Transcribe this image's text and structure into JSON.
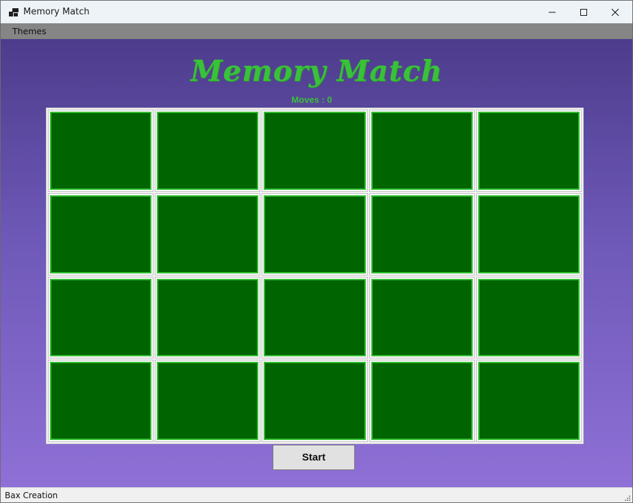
{
  "window": {
    "title": "Memory Match",
    "controls": [
      "minimize-icon",
      "maximize-icon",
      "close-icon"
    ]
  },
  "menu": {
    "items": [
      "Themes"
    ]
  },
  "game": {
    "title": "Memory Match",
    "moves_text": "Moves : 0",
    "moves": 0,
    "rows": 4,
    "columns": 5,
    "card_state": "face-down",
    "start_label": "Start"
  },
  "status": {
    "text": "Bax Creation"
  },
  "colors": {
    "background_top": "#4d3c8c",
    "background_bottom": "#8f70d6",
    "card_back": "#006400",
    "card_border": "#2fbf2f",
    "title_color": "#3ac13a"
  }
}
